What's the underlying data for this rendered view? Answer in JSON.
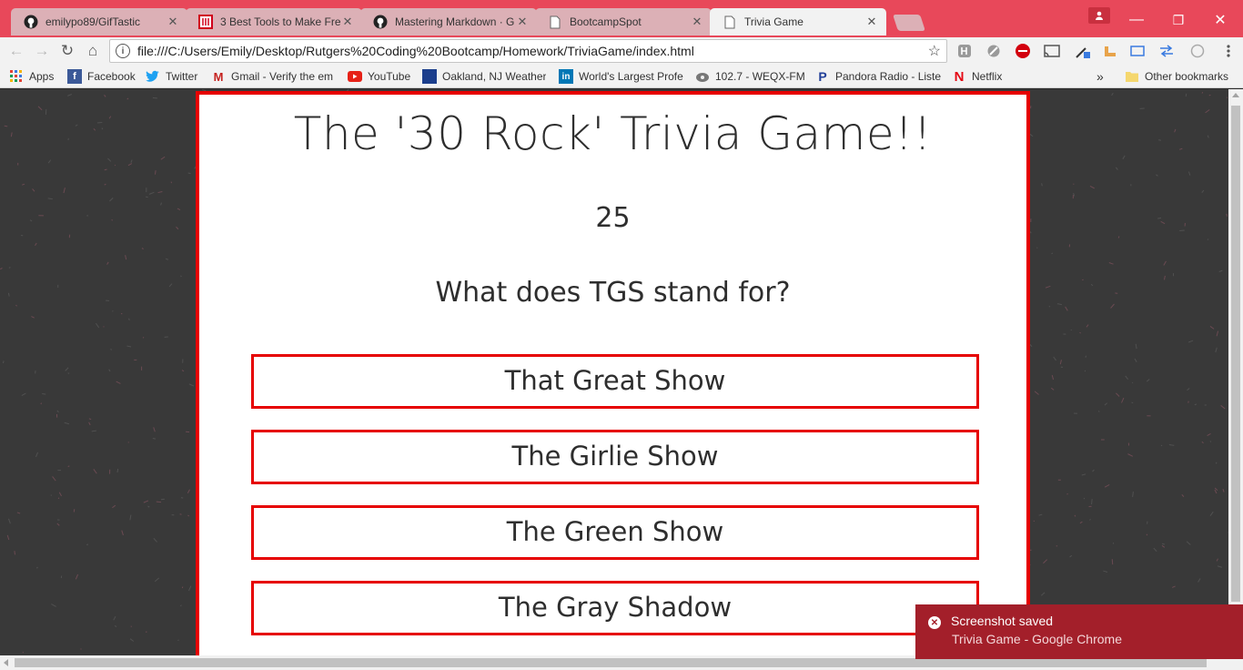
{
  "browser": {
    "tabs": [
      {
        "title": "emilypo89/GifTastic",
        "icon": "github-icon",
        "active": false
      },
      {
        "title": "3 Best Tools to Make Fre",
        "icon": "document-red-icon",
        "active": false
      },
      {
        "title": "Mastering Markdown · G",
        "icon": "github-icon",
        "active": false
      },
      {
        "title": "BootcampSpot",
        "icon": "page-icon",
        "active": false
      },
      {
        "title": "Trivia Game",
        "icon": "page-icon",
        "active": true
      }
    ],
    "tab_close_glyph": "✕",
    "window_controls": {
      "minimize": "—",
      "maximize": "❐",
      "close": "✕"
    },
    "url": "file:///C:/Users/Emily/Desktop/Rutgers%20Coding%20Bootcamp/Homework/TriviaGame/index.html",
    "nav_glyphs": {
      "back": "←",
      "forward": "→",
      "reload": "↻",
      "home": "⌂",
      "info": "i",
      "star": "☆"
    },
    "bookmarks": [
      {
        "label": "Apps",
        "icon": "apps-grid-icon"
      },
      {
        "label": "Facebook",
        "icon": "facebook-icon"
      },
      {
        "label": "Twitter",
        "icon": "twitter-icon"
      },
      {
        "label": "Gmail - Verify the em",
        "icon": "gmail-icon"
      },
      {
        "label": "YouTube",
        "icon": "youtube-icon"
      },
      {
        "label": "Oakland, NJ Weather",
        "icon": "weather-channel-icon"
      },
      {
        "label": "World's Largest Profe",
        "icon": "linkedin-icon"
      },
      {
        "label": "102.7 - WEQX-FM",
        "icon": "radio-icon"
      },
      {
        "label": "Pandora Radio - Liste",
        "icon": "pandora-icon"
      },
      {
        "label": "Netflix",
        "icon": "netflix-icon"
      }
    ],
    "bookmarks_overflow": "»",
    "other_bookmarks": "Other bookmarks"
  },
  "game": {
    "title": "The '30 Rock' Trivia Game!!",
    "timer": "25",
    "question": "What does TGS stand for?",
    "answers": [
      "That Great Show",
      "The Girlie Show",
      "The Green Show",
      "The Gray Shadow"
    ]
  },
  "toast": {
    "title": "Screenshot saved",
    "subtitle": "Trivia Game - Google Chrome",
    "icon_glyph": "✕"
  },
  "colors": {
    "tabstrip": "#e8485a",
    "accent_red": "#e60000",
    "page_bg": "#393939",
    "toast_bg": "#a31f2a"
  }
}
